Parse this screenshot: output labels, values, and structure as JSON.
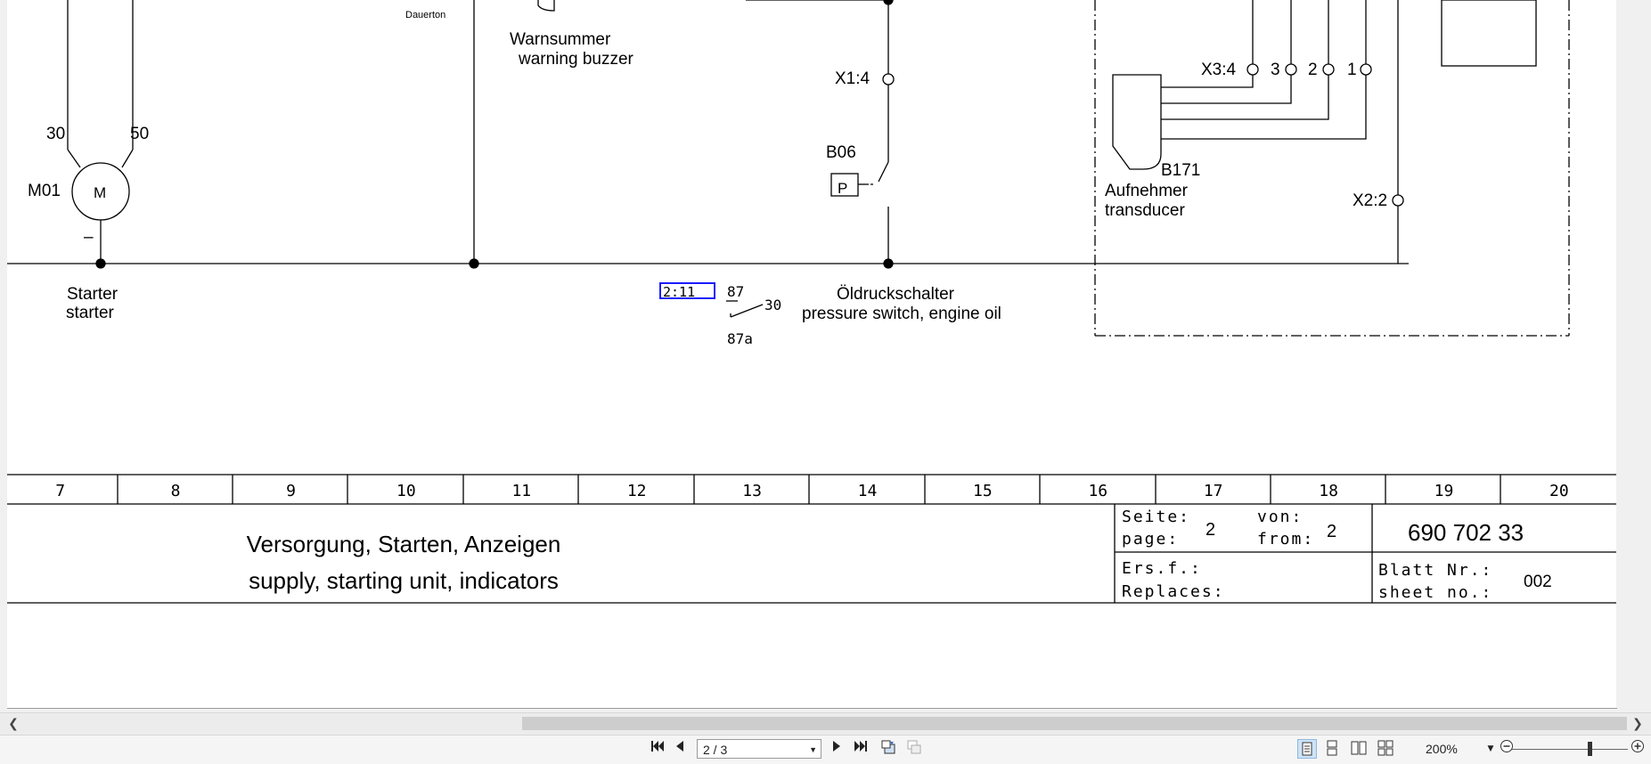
{
  "drawing": {
    "labels": {
      "dauerton": "Dauerton",
      "warnsummer_de": "Warnsummer",
      "warnsummer_en": "warning buzzer",
      "x1_4": "X1:4",
      "b06": "B06",
      "p_symbol": "P",
      "terminal_30": "30",
      "terminal_50": "50",
      "m01": "M01",
      "motor_m": "M",
      "minus": "–",
      "starter_de": "Starter",
      "starter_en": "starter",
      "relay_ref": "2:11",
      "relay_87": "87",
      "relay_30": "30",
      "relay_87a": "87a",
      "oil_switch_de": "Öldruckschalter",
      "oil_switch_en": "pressure switch, engine oil",
      "x3_4": "X3:4",
      "pin_3": "3",
      "pin_2": "2",
      "pin_1": "1",
      "b171": "B171",
      "transducer_de": "Aufnehmer",
      "transducer_en": "transducer",
      "x2_2": "X2:2"
    },
    "columns": [
      "7",
      "8",
      "9",
      "10",
      "11",
      "12",
      "13",
      "14",
      "15",
      "16",
      "17",
      "18",
      "19",
      "20"
    ],
    "title_block": {
      "title_de": "Versorgung, Starten, Anzeigen",
      "title_en": "supply, starting unit, indicators",
      "seite_label": "Seite:",
      "page_label": "page:",
      "page_value": "2",
      "von_label": "von:",
      "from_label": "from:",
      "from_value": "2",
      "drawing_number": "690 702 33",
      "ersf_label": "Ers.f.:",
      "replaces_label": "Replaces:",
      "blatt_label": "Blatt Nr.:",
      "sheet_label": "sheet no.:",
      "sheet_value": "002"
    }
  },
  "toolbar": {
    "page_field": "2 / 3",
    "zoom": "200%"
  },
  "icons": {
    "first": "first-page-icon",
    "prev": "previous-page-icon",
    "next": "next-page-icon",
    "last": "last-page-icon",
    "zoom_out": "zoom-out-icon",
    "zoom_in": "zoom-in-icon"
  }
}
